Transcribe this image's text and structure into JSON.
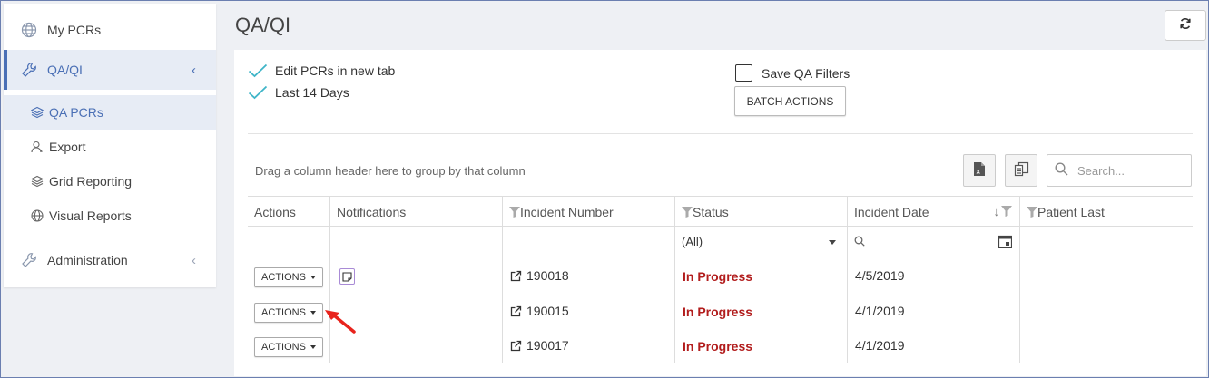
{
  "sidebar": {
    "items": [
      {
        "label": "My PCRs",
        "icon": "globe-icon"
      },
      {
        "label": "QA/QI",
        "icon": "wrench-icon"
      },
      {
        "label": "Administration",
        "icon": "wrench-icon"
      }
    ],
    "sub_items": [
      {
        "label": "QA PCRs",
        "icon": "layers-icon"
      },
      {
        "label": "Export",
        "icon": "user-export-icon"
      },
      {
        "label": "Grid Reporting",
        "icon": "layers-icon"
      },
      {
        "label": "Visual Reports",
        "icon": "globe-icon"
      }
    ]
  },
  "header": {
    "title": "QA/QI",
    "refresh_icon": "refresh-icon"
  },
  "options": {
    "edit_new_tab": "Edit PCRs in new tab",
    "last_14_days": "Last 14 Days",
    "save_filters": "Save QA Filters",
    "batch_actions": "BATCH ACTIONS"
  },
  "toolbar": {
    "group_hint": "Drag a column header here to group by that column",
    "search_placeholder": "Search..."
  },
  "grid": {
    "columns": [
      "Actions",
      "Notifications",
      "Incident Number",
      "Status",
      "Incident Date",
      "Patient Last"
    ],
    "status_filter": "(All)",
    "action_label": "ACTIONS",
    "rows": [
      {
        "incident": "190018",
        "status": "In Progress",
        "date": "4/5/2019",
        "has_note": true
      },
      {
        "incident": "190015",
        "status": "In Progress",
        "date": "4/1/2019",
        "has_note": false
      },
      {
        "incident": "190017",
        "status": "In Progress",
        "date": "4/1/2019",
        "has_note": false
      }
    ]
  },
  "colors": {
    "accent": "#4a6fb5",
    "check": "#3fb5c8",
    "status": "#b21d1d",
    "annotation_arrow": "#e8231c"
  }
}
